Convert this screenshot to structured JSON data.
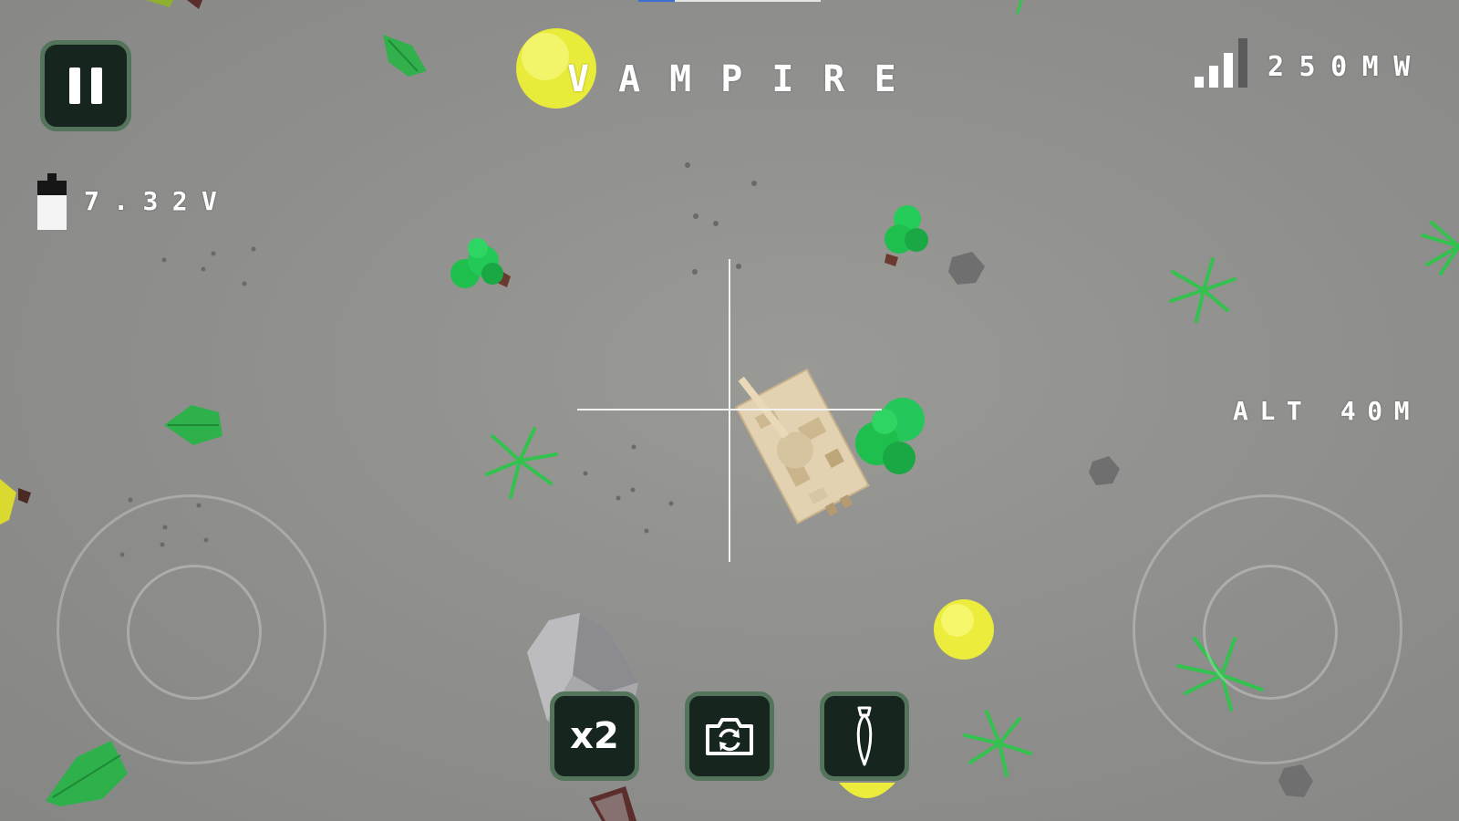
{
  "hud": {
    "mode_label": "VAMPIRE",
    "signal_power": "250MW",
    "signal_strength": 0.75,
    "battery_voltage": "7.32V",
    "battery_level": 0.7,
    "altitude": "ALT 40M",
    "top_progress": 0.2
  },
  "buttons": {
    "pause_icon": "pause-icon",
    "zoom_label": "x2",
    "camera_switch_icon": "camera-switch-icon",
    "drop_icon": "bomb-drop-icon"
  },
  "colors": {
    "button_bg": "#16261f",
    "button_border": "#55745c",
    "ground": "#8e8e8c",
    "foliage": "#2fbf4f",
    "tank_camo": "#e1d1b1"
  }
}
